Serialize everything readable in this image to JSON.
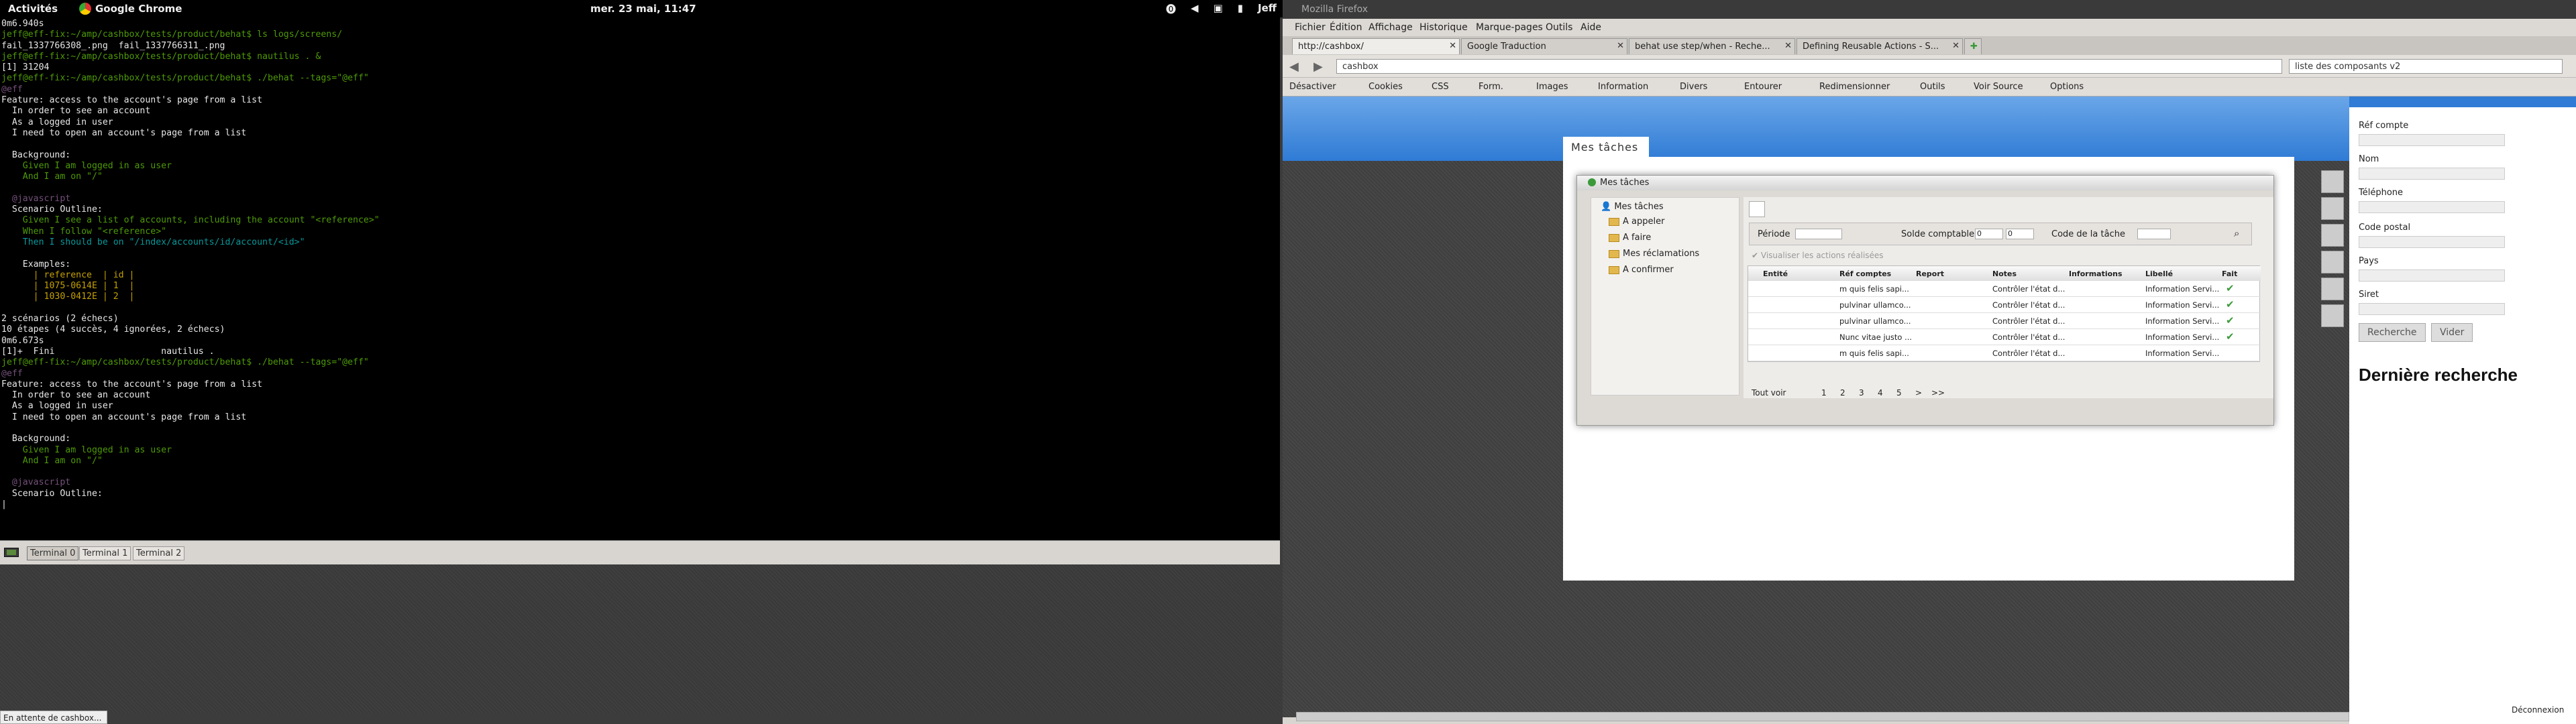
{
  "topbar": {
    "activities": "Activités",
    "app": "Google Chrome",
    "clock": "mer. 23 mai, 11:47",
    "user": "Jeff"
  },
  "terminal": {
    "lines": [
      "0m6.940s",
      "jeff@eff-fix:~/amp/cashbox/tests/product/behat$ ls logs/screens/",
      "fail_1337766308_.png  fail_1337766311_.png",
      "jeff@eff-fix:~/amp/cashbox/tests/product/behat$ nautilus . &",
      "[1] 31204",
      "jeff@eff-fix:~/amp/cashbox/tests/product/behat$ ./behat --tags=\"@eff\"",
      "@eff",
      "Feature: access to the account's page from a list",
      "  In order to see an account",
      "  As a logged in user",
      "  I need to open an account's page from a list",
      "",
      "  Background:",
      "    Given I am logged in as user",
      "    And I am on \"/\"",
      "",
      "  @javascript",
      "  Scenario Outline:",
      "    Given I see a list of accounts, including the account \"<reference>\"",
      "    When I follow \"<reference>\"",
      "    Then I should be on \"/index/accounts/id/account/<id>\"",
      "",
      "    Examples:",
      "      | reference  | id |",
      "      | 1075-0614E | 1  |",
      "      | 1030-0412E | 2  |",
      "",
      "2 scénarios (2 échecs)",
      "10 étapes (4 succès, 4 ignorées, 2 échecs)",
      "0m6.673s",
      "[1]+  Fini                    nautilus .",
      "jeff@eff-fix:~/amp/cashbox/tests/product/behat$ ./behat --tags=\"@eff\"",
      "@eff",
      "Feature: access to the account's page from a list",
      "  In order to see an account",
      "  As a logged in user",
      "  I need to open an account's page from a list",
      "",
      "  Background:",
      "    Given I am logged in as user",
      "    And I am on \"/\"",
      "",
      "  @javascript",
      "  Scenario Outline:",
      "|"
    ],
    "tabs": [
      "Terminal 0",
      "Terminal 1",
      "Terminal 2"
    ]
  },
  "status_text": "En attente de cashbox...",
  "firefox": {
    "window_title": "Mozilla Firefox",
    "menu": [
      "Fichier",
      "Édition",
      "Affichage",
      "Historique",
      "Marque-pages",
      "Outils",
      "Aide"
    ],
    "tabs": [
      "http://cashbox/",
      "Google Traduction",
      "behat use step/when - Reche...",
      "Defining Reusable Actions - S..."
    ],
    "url": "cashbox",
    "search": "liste des composants v2",
    "devbar": [
      "Désactiver",
      "Cookies",
      "CSS",
      "Form.",
      "Images",
      "Information",
      "Divers",
      "Entourer",
      "Redimensionner",
      "Outils",
      "Voir Source",
      "Options"
    ]
  },
  "app": {
    "page_tab": "Mes tâches",
    "window_title": "Mes tâches",
    "tree": {
      "root": "Mes tâches",
      "items": [
        "A appeler",
        "A faire",
        "Mes réclamations",
        "A confirmer"
      ]
    },
    "filter": {
      "periode": "Période",
      "solde": "Solde comptable",
      "solde_from": "0",
      "solde_to": "0",
      "code": "Code de la tâche"
    },
    "show_done": "Visualiser les actions réalisées",
    "columns": [
      "Entité",
      "Réf comptes",
      "Report",
      "Notes",
      "Informations",
      "Libellé",
      "Fait"
    ],
    "rows": [
      {
        "ref": "m quis felis sapi...",
        "notes": "Contrôler l'état d...",
        "libelle": "Information Servi...",
        "done": "✔"
      },
      {
        "ref": "pulvinar ullamco...",
        "notes": "Contrôler l'état d...",
        "libelle": "Information Servi...",
        "done": "✔"
      },
      {
        "ref": "pulvinar ullamco...",
        "notes": "Contrôler l'état d...",
        "libelle": "Information Servi...",
        "done": "✔"
      },
      {
        "ref": "Nunc vitae justo ...",
        "notes": "Contrôler l'état d...",
        "libelle": "Information Servi...",
        "done": "✔"
      },
      {
        "ref": "m quis felis sapi...",
        "notes": "Contrôler l'état d...",
        "libelle": "Information Servi...",
        "done": ""
      }
    ],
    "pager": {
      "all": "Tout voir",
      "pages": [
        "1",
        "2",
        "3",
        "4",
        "5",
        ">",
        ">>"
      ]
    },
    "sidebar": {
      "fields": [
        "Réf compte",
        "Nom",
        "Téléphone",
        "Code postal",
        "Pays",
        "Siret"
      ],
      "search_btn": "Recherche",
      "clear_btn": "Vider",
      "last_search": "Dernière recherche",
      "logout": "Déconnexion"
    }
  }
}
